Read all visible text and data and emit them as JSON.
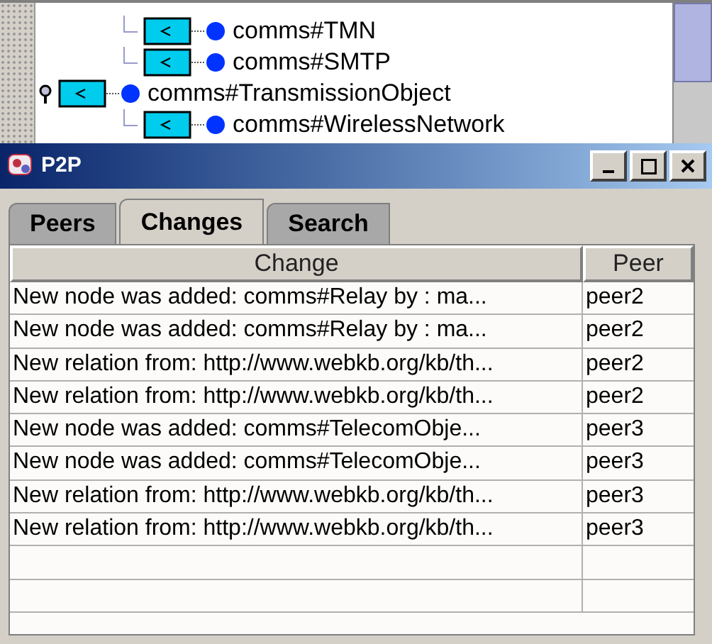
{
  "tree": {
    "continued_children": [
      {
        "label": "comms#TMN"
      },
      {
        "label": "comms#SMTP"
      }
    ],
    "items": [
      {
        "label": "comms#TransmissionObject",
        "expanded": true,
        "children": [
          {
            "label": "comms#WirelessNetwork"
          }
        ]
      }
    ]
  },
  "window": {
    "title": "P2P"
  },
  "tabs": [
    {
      "label": "Peers",
      "selected": false
    },
    {
      "label": "Changes",
      "selected": true
    },
    {
      "label": "Search",
      "selected": false
    }
  ],
  "table": {
    "columns": [
      "Change",
      "Peer"
    ],
    "rows": [
      [
        "New node was added: comms#Relay by : ma...",
        "peer2"
      ],
      [
        "New node was added: comms#Relay by : ma...",
        "peer2"
      ],
      [
        "New relation from: http://www.webkb.org/kb/th...",
        "peer2"
      ],
      [
        "New relation from: http://www.webkb.org/kb/th...",
        "peer2"
      ],
      [
        "New node was added: comms#TelecomObje...",
        "peer3"
      ],
      [
        "New node was added: comms#TelecomObje...",
        "peer3"
      ],
      [
        "New relation from: http://www.webkb.org/kb/th...",
        "peer3"
      ],
      [
        "New relation from: http://www.webkb.org/kb/th...",
        "peer3"
      ]
    ]
  }
}
